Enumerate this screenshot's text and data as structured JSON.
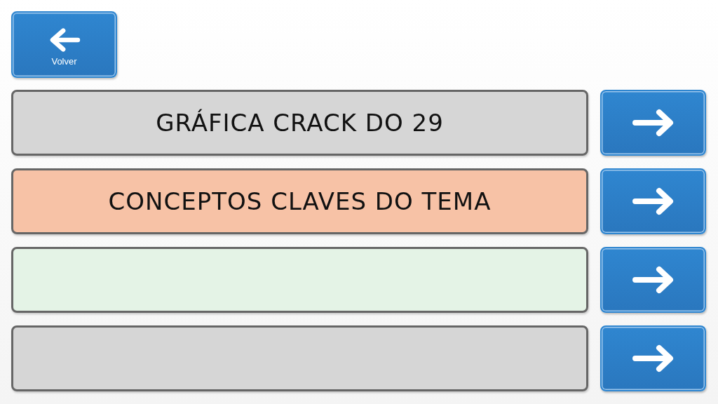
{
  "back_button": {
    "label": "Volver"
  },
  "rows": [
    {
      "label": "GRÁFICA CRACK DO 29",
      "color": "#d6d6d6"
    },
    {
      "label": "CONCEPTOS CLAVES DO TEMA",
      "color": "#f7c2a6"
    },
    {
      "color": "#e4f3e6"
    },
    {
      "color": "#d6d6d6"
    }
  ]
}
